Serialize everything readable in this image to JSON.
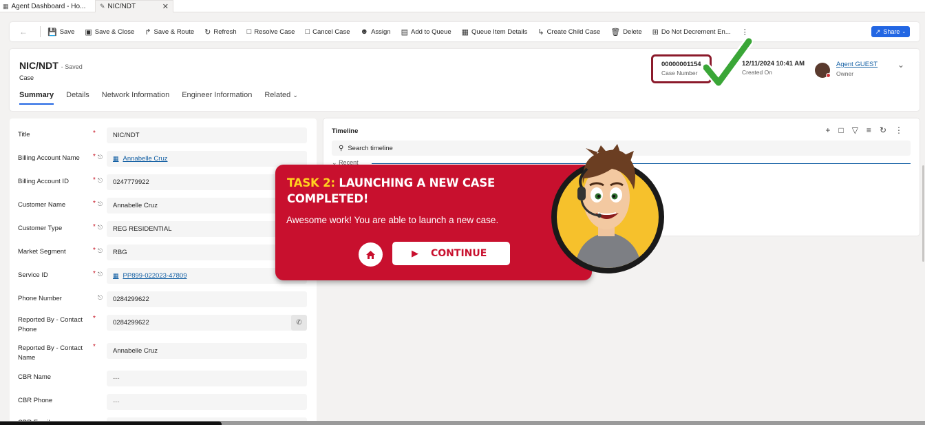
{
  "tabs": [
    {
      "label": "Agent Dashboard - Ho..."
    },
    {
      "label": "NIC/NDT"
    }
  ],
  "toolbar": {
    "save": "Save",
    "save_close": "Save & Close",
    "save_route": "Save & Route",
    "refresh": "Refresh",
    "resolve": "Resolve Case",
    "cancel": "Cancel Case",
    "assign": "Assign",
    "add_queue": "Add to Queue",
    "queue_details": "Queue Item Details",
    "child_case": "Create Child Case",
    "delete": "Delete",
    "no_decrement": "Do Not Decrement En...",
    "share": "Share"
  },
  "record": {
    "title": "NIC/NDT",
    "saved": "- Saved",
    "entity": "Case",
    "tabs": [
      "Summary",
      "Details",
      "Network Information",
      "Engineer Information",
      "Related"
    ],
    "case_number": "00000001154",
    "case_number_label": "Case Number",
    "created_on": "12/11/2024 10:41 AM",
    "created_on_label": "Created On",
    "owner": "Agent GUEST",
    "owner_label": "Owner"
  },
  "fields": [
    {
      "label": "Title",
      "value": "NIC/NDT"
    },
    {
      "label": "Billing Account Name",
      "value": "Annabelle Cruz"
    },
    {
      "label": "Billing Account ID",
      "value": "0247779922"
    },
    {
      "label": "Customer Name",
      "value": "Annabelle Cruz"
    },
    {
      "label": "Customer Type",
      "value": "REG RESIDENTIAL"
    },
    {
      "label": "Market Segment",
      "value": "RBG"
    },
    {
      "label": "Service ID",
      "value": "PP899-022023-47809"
    },
    {
      "label": "Phone Number",
      "value": "0284299622"
    },
    {
      "label": "Reported By - Contact Phone",
      "value": "0284299622"
    },
    {
      "label": "Reported By - Contact Name",
      "value": "Annabelle Cruz"
    },
    {
      "label": "CBR Name",
      "value": "---"
    },
    {
      "label": "CBR Phone",
      "value": "---"
    },
    {
      "label": "CBR Email",
      "value": ""
    }
  ],
  "timeline": {
    "title": "Timeline",
    "search_placeholder": "Search timeline",
    "recent": "Recent"
  },
  "popup": {
    "task_prefix": "TASK 2:",
    "heading_line1": " LAUNCHING A NEW CASE",
    "heading_line2": "COMPLETED!",
    "message": "Awesome work! You are able to launch a new case.",
    "continue": "CONTINUE"
  },
  "colors": {
    "accent": "#2266e3",
    "popup_red": "#c8102e",
    "task_yellow": "#ffd21f",
    "highlight_border": "#8b1a2b",
    "check_green": "#3aa637"
  },
  "icons": [
    "save-icon",
    "refresh-icon",
    "delete-icon",
    "share-icon",
    "phone-icon",
    "lock-icon",
    "home-icon",
    "play-icon",
    "checkmark-icon"
  ]
}
